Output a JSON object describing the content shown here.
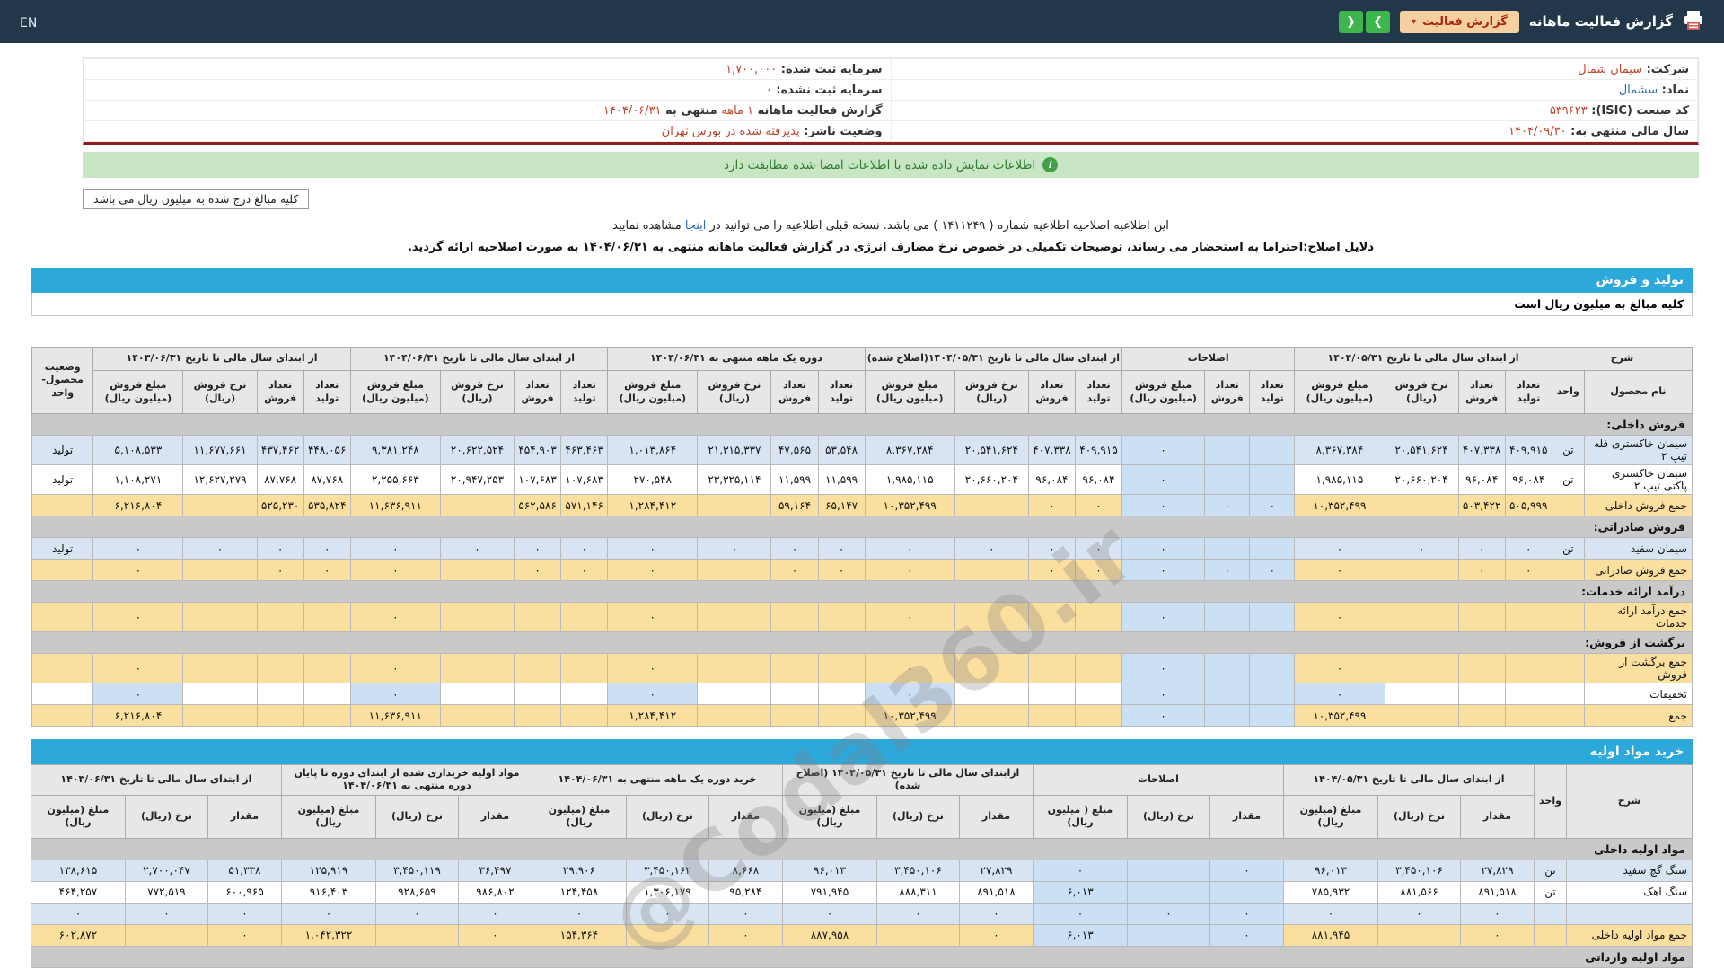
{
  "navbar": {
    "title": "گزارش فعالیت ماهانه",
    "dropdown_label": "گزارش فعالیت",
    "caret": "▾",
    "next_icon": "❯",
    "prev_icon": "❮",
    "lang": "EN"
  },
  "colors": {
    "navbar_bg": "#22384a",
    "section_bar_blue": "#2ca8db",
    "sum_row_yellow": "#fbdf9e",
    "data_row_blue": "#d8e4f2",
    "correction_cell_blue": "#cce0f5",
    "section_row_gray": "#c9c9c9",
    "green_banner_bg": "#c8e6c4",
    "value_red": "#c0432b",
    "divider_dark_red": "#921d1d",
    "green_button": "#3fb64b",
    "dropdown_bg": "#f6d0a0"
  },
  "info_rows": [
    [
      [
        {
          "t": "شرکت:  ",
          "c": "lbl"
        },
        {
          "t": "سیمان شمال",
          "c": "red"
        }
      ],
      [
        {
          "t": "سرمایه ثبت شده:  ",
          "c": "lbl"
        },
        {
          "t": "۱,۷۰۰,۰۰۰",
          "c": "red"
        }
      ]
    ],
    [
      [
        {
          "t": "نماد:  ",
          "c": "lbl"
        },
        {
          "t": "سشمال",
          "c": "blue"
        }
      ],
      [
        {
          "t": "سرمایه ثبت نشده:  ",
          "c": "lbl"
        },
        {
          "t": "۰",
          "c": "red"
        }
      ]
    ],
    [
      [
        {
          "t": "کد صنعت (ISIC):  ",
          "c": "lbl"
        },
        {
          "t": "۵۳۹۶۲۳",
          "c": "red"
        }
      ],
      [
        {
          "t": "گزارش فعالیت ماهانه ",
          "c": "lbl"
        },
        {
          "t": "۱ ماهه",
          "c": "red"
        },
        {
          "t": " منتهی به ",
          "c": "lbl"
        },
        {
          "t": "۱۴۰۴/۰۶/۳۱",
          "c": "red"
        }
      ]
    ],
    [
      [
        {
          "t": "سال مالی منتهی به:  ",
          "c": "lbl"
        },
        {
          "t": "۱۴۰۴/۰۹/۳۰",
          "c": "red"
        }
      ],
      [
        {
          "t": "وضعیت ناشر:  ",
          "c": "lbl"
        },
        {
          "t": "پذیرفته شده در بورس تهران",
          "c": "red"
        }
      ]
    ]
  ],
  "banner": {
    "icon": "i",
    "text": "اطلاعات نمایش داده شده با اطلاعات امضا شده مطابقت دارد"
  },
  "notes": {
    "amounts": "کلیه مبالغ درج شده به میلیون ریال می باشد"
  },
  "notice": {
    "before": "این اطلاعیه اصلاحیه اطلاعیه شماره ( ۱۴۱۱۲۴۹ ) می باشد. نسخه قبلی اطلاعیه را می توانید در ",
    "link": "اینجا",
    "after": " مشاهده نمایید",
    "reason": "دلایل اصلاح:احتراما به استحضار می رساند، توضیحات تکمیلی در خصوص نرخ مصارف انرژی در گزارش فعالیت ماهانه منتهی به ۱۴۰۴/۰۶/۳۱ به صورت اصلاحیه ارائه گردید."
  },
  "watermark": "@Codal360.ir",
  "section1": {
    "title": "تولید و فروش",
    "subtitle": "کلیه مبالغ به میلیون ریال است",
    "header": [
      {
        "label": "شرح",
        "cols": [
          "نام محصول",
          "واحد"
        ]
      },
      {
        "label": "از ابتدای سال مالی تا تاریخ ۱۴۰۴/۰۵/۳۱",
        "cols": [
          "تعداد تولید",
          "تعداد فروش",
          "نرخ فروش (ریال)",
          "مبلغ فروش (میلیون ریال)"
        ]
      },
      {
        "label": "اصلاحات",
        "cols": [
          "تعداد تولید",
          "تعداد فروش",
          "مبلغ فروش (میلیون ریال)"
        ]
      },
      {
        "label": "از ابتدای سال مالی تا تاریخ ۱۴۰۴/۰۵/۳۱(اصلاح شده)",
        "cols": [
          "تعداد تولید",
          "تعداد فروش",
          "نرخ فروش (ریال)",
          "مبلغ فروش (میلیون ریال)"
        ]
      },
      {
        "label": "دوره یک ماهه منتهی به ۱۴۰۴/۰۶/۳۱",
        "cols": [
          "تعداد تولید",
          "تعداد فروش",
          "نرخ فروش (ریال)",
          "مبلغ فروش (میلیون ریال)"
        ]
      },
      {
        "label": "از ابتدای سال مالی تا تاریخ ۱۴۰۴/۰۶/۳۱",
        "cols": [
          "تعداد تولید",
          "تعداد فروش",
          "نرخ فروش (ریال)",
          "مبلغ فروش (میلیون ریال)"
        ]
      },
      {
        "label": "از ابتدای سال مالی تا تاریخ ۱۴۰۳/۰۶/۳۱",
        "cols": [
          "تعداد تولید",
          "تعداد فروش",
          "نرخ فروش (ریال)",
          "مبلغ فروش (میلیون ریال)"
        ]
      },
      {
        "label": "وضعیت محصول-واحد"
      }
    ],
    "rows": [
      {
        "section": "فروش داخلی:"
      },
      {
        "s": "blue",
        "c": [
          "سیمان خاکستری فله تیپ ۲",
          "تن",
          "۴۰۹,۹۱۵",
          "۴۰۷,۳۳۸",
          "۲۰,۵۴۱,۶۲۴",
          "۸,۳۶۷,۳۸۴",
          "",
          "",
          "۰",
          "۴۰۹,۹۱۵",
          "۴۰۷,۳۳۸",
          "۲۰,۵۴۱,۶۲۴",
          "۸,۳۶۷,۳۸۴",
          "۵۳,۵۴۸",
          "۴۷,۵۶۵",
          "۲۱,۳۱۵,۳۳۷",
          "۱,۰۱۳,۸۶۴",
          "۴۶۳,۴۶۳",
          "۴۵۴,۹۰۳",
          "۲۰,۶۲۲,۵۲۴",
          "۹,۳۸۱,۲۴۸",
          "۴۴۸,۰۵۶",
          "۴۳۷,۴۶۲",
          "۱۱,۶۷۷,۶۶۱",
          "۵,۱۰۸,۵۳۳",
          "تولید"
        ]
      },
      {
        "s": "white",
        "c": [
          "سیمان خاکستری پاکتی تیپ ۲",
          "تن",
          "۹۶,۰۸۴",
          "۹۶,۰۸۴",
          "۲۰,۶۶۰,۲۰۴",
          "۱,۹۸۵,۱۱۵",
          "",
          "",
          "۰",
          "۹۶,۰۸۴",
          "۹۶,۰۸۴",
          "۲۰,۶۶۰,۲۰۴",
          "۱,۹۸۵,۱۱۵",
          "۱۱,۵۹۹",
          "۱۱,۵۹۹",
          "۲۳,۳۲۵,۱۱۴",
          "۲۷۰,۵۴۸",
          "۱۰۷,۶۸۳",
          "۱۰۷,۶۸۳",
          "۲۰,۹۴۷,۲۵۳",
          "۲,۲۵۵,۶۶۳",
          "۸۷,۷۶۸",
          "۸۷,۷۶۸",
          "۱۲,۶۲۷,۲۷۹",
          "۱,۱۰۸,۲۷۱",
          "تولید"
        ]
      },
      {
        "s": "sum",
        "c": [
          "جمع فروش داخلی",
          "",
          "۵۰۵,۹۹۹",
          "۵۰۳,۴۲۲",
          "",
          "۱۰,۳۵۲,۴۹۹",
          "۰",
          "۰",
          "۰",
          "۰",
          "۰",
          "",
          "۱۰,۳۵۲,۴۹۹",
          "۶۵,۱۴۷",
          "۵۹,۱۶۴",
          "",
          "۱,۲۸۴,۴۱۲",
          "۵۷۱,۱۴۶",
          "۵۶۲,۵۸۶",
          "",
          "۱۱,۶۳۶,۹۱۱",
          "۵۳۵,۸۲۴",
          "۵۲۵,۲۳۰",
          "",
          "۶,۲۱۶,۸۰۴",
          ""
        ]
      },
      {
        "section": "فروش صادراتی:"
      },
      {
        "s": "blue",
        "c": [
          "سیمان سفید",
          "تن",
          "۰",
          "۰",
          "۰",
          "۰",
          "",
          "",
          "۰",
          "۰",
          "۰",
          "۰",
          "۰",
          "۰",
          "۰",
          "۰",
          "۰",
          "۰",
          "۰",
          "۰",
          "۰",
          "۰",
          "۰",
          "۰",
          "۰",
          "تولید"
        ]
      },
      {
        "s": "sum",
        "c": [
          "جمع فروش صادراتی",
          "",
          "۰",
          "۰",
          "",
          "۰",
          "۰",
          "۰",
          "۰",
          "۰",
          "۰",
          "",
          "۰",
          "۰",
          "۰",
          "",
          "۰",
          "۰",
          "۰",
          "",
          "۰",
          "۰",
          "۰",
          "",
          "۰",
          ""
        ]
      },
      {
        "section": "درآمد ارائه خدمات:"
      },
      {
        "s": "sum",
        "c": [
          "جمع درآمد ارائه خدمات",
          "",
          "",
          "",
          "",
          "۰",
          "",
          "",
          "۰",
          "",
          "",
          "",
          "۰",
          "",
          "",
          "",
          "۰",
          "",
          "",
          "",
          "۰",
          "",
          "",
          "",
          "۰",
          ""
        ]
      },
      {
        "section": "برگشت از فروش:"
      },
      {
        "s": "sum",
        "c": [
          "جمع برگشت از فروش",
          "",
          "",
          "",
          "",
          "۰",
          "",
          "",
          "۰",
          "",
          "",
          "",
          "۰",
          "",
          "",
          "",
          "۰",
          "",
          "",
          "",
          "۰",
          "",
          "",
          "",
          "۰",
          ""
        ]
      },
      {
        "s": "disc",
        "c": [
          "تخفیفات",
          "",
          "",
          "",
          "",
          "۰",
          "",
          "",
          "۰",
          "",
          "",
          "",
          "۰",
          "",
          "",
          "",
          "۰",
          "",
          "",
          "",
          "۰",
          "",
          "",
          "",
          "۰",
          ""
        ]
      },
      {
        "s": "sum",
        "c": [
          "جمع",
          "",
          "",
          "",
          "",
          "۱۰,۳۵۲,۴۹۹",
          "",
          "",
          "۰",
          "",
          "",
          "",
          "۱۰,۳۵۲,۴۹۹",
          "",
          "",
          "",
          "۱,۲۸۴,۴۱۲",
          "",
          "",
          "",
          "۱۱,۶۳۶,۹۱۱",
          "",
          "",
          "",
          "۶,۲۱۶,۸۰۴",
          ""
        ]
      }
    ]
  },
  "section2": {
    "title": "خرید مواد اولیه",
    "header": [
      {
        "label": "شرح"
      },
      {
        "label": "واحد"
      },
      {
        "label": "از ابتدای سال مالی تا تاریخ ۱۴۰۴/۰۵/۳۱",
        "cols": [
          "مقدار",
          "نرخ (ریال)",
          "مبلغ (میلیون ریال)"
        ]
      },
      {
        "label": "اصلاحات",
        "cols": [
          "مقدار",
          "نرخ (ریال)",
          "مبلغ ( میلیون ریال)"
        ]
      },
      {
        "label": "ازابتدای سال مالی تا تاریخ ۱۴۰۴/۰۵/۳۱ (اصلاح شده)",
        "cols": [
          "مقدار",
          "نرخ (ریال)",
          "مبلغ (میلیون ریال)"
        ]
      },
      {
        "label": "خرید دوره یک ماهه منتهی به ۱۴۰۴/۰۶/۳۱",
        "cols": [
          "مقدار",
          "نرخ (ریال)",
          "مبلغ (میلیون ریال)"
        ]
      },
      {
        "label": "مواد اولیه خریداری شده از ابتدای دوره تا پایان دوره منتهی به ۱۴۰۴/۰۶/۳۱",
        "cols": [
          "مقدار",
          "نرخ (ریال)",
          "مبلغ (میلیون ریال)"
        ]
      },
      {
        "label": "از ابتدای سال مالی تا تاریخ ۱۴۰۳/۰۶/۳۱",
        "cols": [
          "مقدار",
          "نرخ (ریال)",
          "مبلغ (میلیون ریال)"
        ]
      }
    ],
    "rows": [
      {
        "section": "مواد اولیه داخلی"
      },
      {
        "s": "blue",
        "c": [
          "سنگ گچ سفید",
          "تن",
          "۲۷,۸۲۹",
          "۳,۴۵۰,۱۰۶",
          "۹۶,۰۱۳",
          "۰",
          "",
          "۰",
          "۲۷,۸۲۹",
          "۳,۴۵۰,۱۰۶",
          "۹۶,۰۱۳",
          "۸,۶۶۸",
          "۳,۴۵۰,۱۶۲",
          "۲۹,۹۰۶",
          "۳۶,۴۹۷",
          "۳,۴۵۰,۱۱۹",
          "۱۲۵,۹۱۹",
          "۵۱,۳۳۸",
          "۲,۷۰۰,۰۴۷",
          "۱۳۸,۶۱۵"
        ]
      },
      {
        "s": "white",
        "c": [
          "سنگ آهک",
          "تن",
          "۸۹۱,۵۱۸",
          "۸۸۱,۵۶۶",
          "۷۸۵,۹۳۲",
          "",
          "",
          "۶,۰۱۳",
          "۸۹۱,۵۱۸",
          "۸۸۸,۳۱۱",
          "۷۹۱,۹۴۵",
          "۹۵,۲۸۴",
          "۱,۳۰۶,۱۷۹",
          "۱۲۴,۴۵۸",
          "۹۸۶,۸۰۲",
          "۹۲۸,۶۵۹",
          "۹۱۶,۴۰۳",
          "۶۰۰,۹۶۵",
          "۷۷۲,۵۱۹",
          "۴۶۴,۲۵۷"
        ]
      },
      {
        "s": "blue",
        "c": [
          "",
          "",
          "۰",
          "۰",
          "۰",
          "۰",
          "۰",
          "۰",
          "۰",
          "۰",
          "۰",
          "۰",
          "۰",
          "۰",
          "۰",
          "۰",
          "۰",
          "۰",
          "۰",
          "۰"
        ]
      },
      {
        "s": "sum",
        "c": [
          "جمع مواد اولیه داخلی",
          "",
          "۰",
          "",
          "۸۸۱,۹۴۵",
          "۰",
          "",
          "۶,۰۱۳",
          "۰",
          "",
          "۸۸۷,۹۵۸",
          "۰",
          "",
          "۱۵۴,۳۶۴",
          "۰",
          "",
          "۱,۰۴۲,۳۲۲",
          "۰",
          "",
          "۶۰۲,۸۷۲"
        ]
      },
      {
        "section": "مواد اولیه وارداتی"
      }
    ]
  }
}
